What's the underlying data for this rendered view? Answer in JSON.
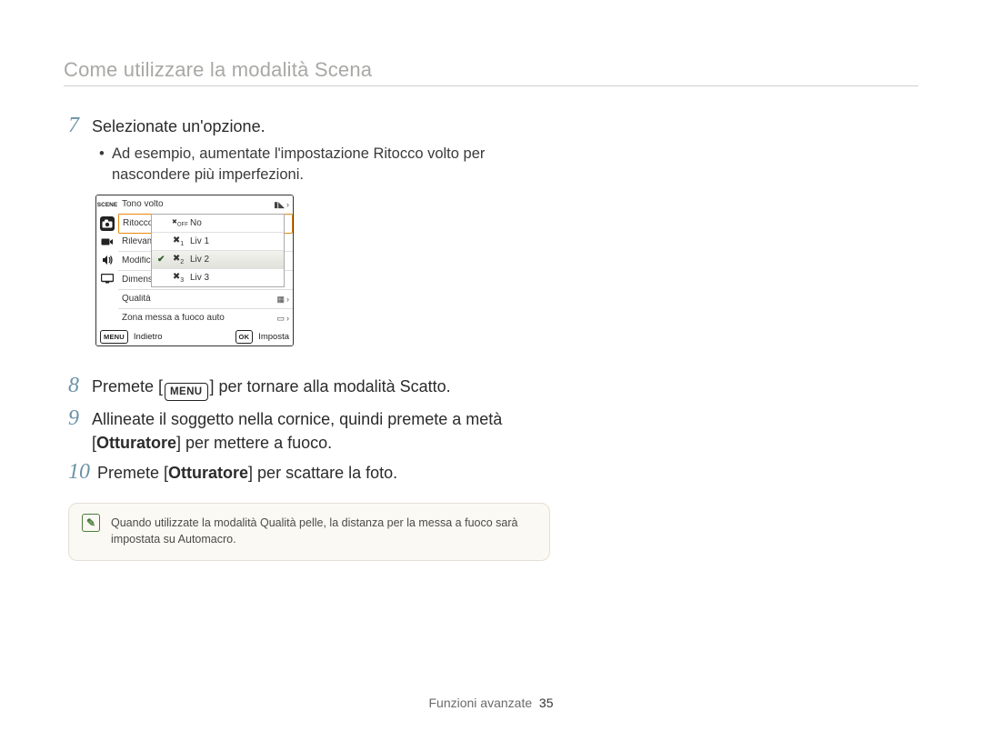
{
  "header": {
    "title": "Come utilizzare la modalità Scena"
  },
  "steps": {
    "s7": {
      "num": "7",
      "text": "Selezionate un'opzione.",
      "bullet": "Ad esempio, aumentate l'impostazione Ritocco volto per nascondere più imperfezioni."
    },
    "s8": {
      "num": "8",
      "pre": "Premete [",
      "key": "MENU",
      "post": "] per tornare alla modalità Scatto."
    },
    "s9": {
      "num": "9",
      "line1": "Allineate il soggetto nella cornice, quindi premete a metà",
      "bold": "Otturatore",
      "line2_pre": "[",
      "line2_post": "] per mettere a fuoco."
    },
    "s10": {
      "num": "10",
      "pre": "Premete [",
      "bold": "Otturatore",
      "post": "] per scattare la foto."
    }
  },
  "camera": {
    "scene_label": "SCENE",
    "rows": {
      "r1": {
        "label": "Tono volto"
      },
      "r2": {
        "label": "Ritocco"
      },
      "r3": {
        "label": "Rilevame"
      },
      "r4": {
        "label": "Modifica"
      },
      "r5": {
        "label": "Dimensio"
      },
      "r6": {
        "label": "Qualità"
      },
      "r7": {
        "label": "Zona messa a fuoco auto"
      }
    },
    "popup": {
      "p0": {
        "icon": "OFF",
        "label": "No"
      },
      "p1": {
        "icon": "1",
        "label": "Liv 1"
      },
      "p2": {
        "icon": "2",
        "label": "Liv 2"
      },
      "p3": {
        "icon": "3",
        "label": "Liv 3"
      }
    },
    "footer": {
      "back_key": "MENU",
      "back_label": "Indietro",
      "set_key": "OK",
      "set_label": "Imposta"
    }
  },
  "note": {
    "text": "Quando utilizzate la modalità Qualità pelle, la distanza per la messa a fuoco sarà impostata su Automacro."
  },
  "footer": {
    "section": "Funzioni avanzate",
    "page": "35"
  }
}
